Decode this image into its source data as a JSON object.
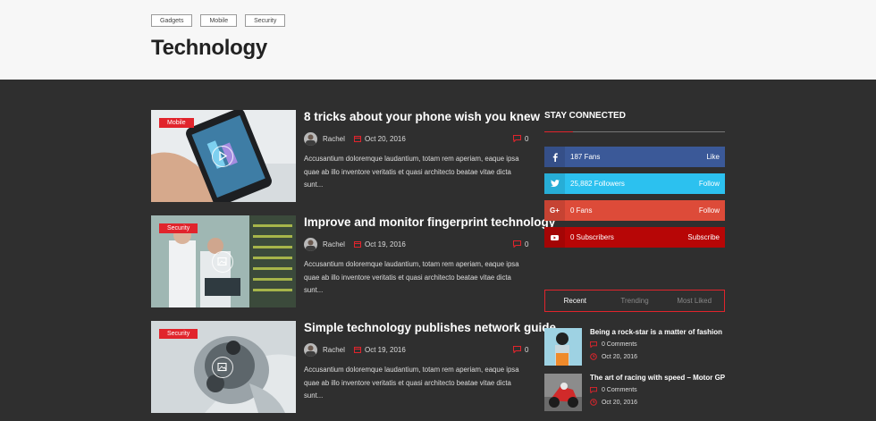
{
  "header": {
    "tags": [
      "Gadgets",
      "Mobile",
      "Security"
    ],
    "title": "Technology"
  },
  "posts": [
    {
      "category": "Mobile",
      "title": "8 tricks about your phone wish you knew",
      "author": "Rachel",
      "date": "Oct 20, 2016",
      "comments": "0",
      "excerpt": "Accusantium doloremque laudantium, totam rem aperiam, eaque ipsa quae ab illo inventore veritatis et quasi architecto beatae vitae dicta sunt...",
      "media_icon": "play-icon"
    },
    {
      "category": "Security",
      "title": "Improve and monitor fingerprint technology",
      "author": "Rachel",
      "date": "Oct 19, 2016",
      "comments": "0",
      "excerpt": "Accusantium doloremque laudantium, totam rem aperiam, eaque ipsa quae ab illo inventore veritatis et quasi architecto beatae vitae dicta sunt...",
      "media_icon": "gallery-icon"
    },
    {
      "category": "Security",
      "title": "Simple technology publishes network guide",
      "author": "Rachel",
      "date": "Oct 19, 2016",
      "comments": "0",
      "excerpt": "Accusantium doloremque laudantium, totam rem aperiam, eaque ipsa quae ab illo inventore veritatis et quasi architecto beatae vitae dicta sunt...",
      "media_icon": "gallery-icon"
    }
  ],
  "sidebar": {
    "stay_connected": "STAY CONNECTED",
    "social": [
      {
        "icon": "facebook-icon",
        "count": "187 Fans",
        "action": "Like",
        "color": "#3b5998"
      },
      {
        "icon": "twitter-icon",
        "count": "25,882 Followers",
        "action": "Follow",
        "color": "#2cc1ef"
      },
      {
        "icon": "google-plus-icon",
        "count": "0 Fans",
        "action": "Follow",
        "color": "#dd4b39"
      },
      {
        "icon": "youtube-icon",
        "count": "0 Subscribers",
        "action": "Subscribe",
        "color": "#b70606"
      }
    ],
    "tabs": [
      "Recent",
      "Trending",
      "Most Liked"
    ],
    "recent": [
      {
        "title": "Being a rock-star is a matter of fashion",
        "comments": "0 Comments",
        "date": "Oct 20, 2016"
      },
      {
        "title": "The art of racing with speed – Motor GP",
        "comments": "0 Comments",
        "date": "Oct 20, 2016"
      }
    ]
  },
  "colors": {
    "accent": "#e1242c",
    "dark_bg": "#2f2f2f",
    "header_bg": "#f7f7f7"
  }
}
